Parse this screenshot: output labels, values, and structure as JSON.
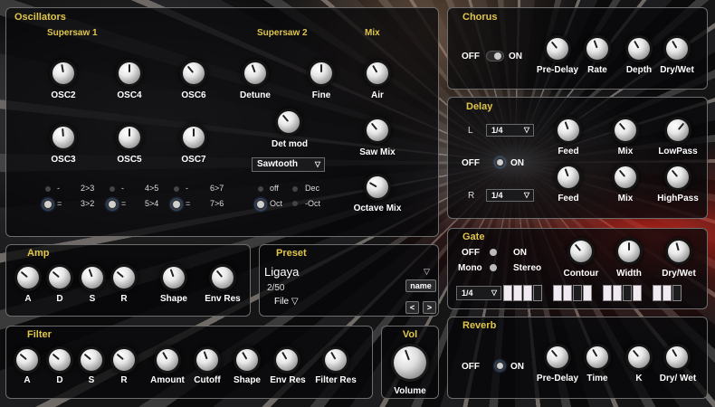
{
  "oscillators": {
    "title": "Oscillators",
    "supersaw1": "Supersaw 1",
    "supersaw2": "Supersaw 2",
    "mix": "Mix",
    "knobs": [
      "OSC2",
      "OSC4",
      "OSC6",
      "OSC3",
      "OSC5",
      "OSC7",
      "Detune",
      "Fine",
      "Air",
      "Det mod",
      "Saw Mix",
      "Octave Mix"
    ],
    "waveform": "Sawtooth",
    "dash": "-",
    "eq": "=",
    "pairs": [
      "2>3",
      "3>2",
      "4>5",
      "5>4",
      "6>7",
      "7>6"
    ],
    "mod_opts": [
      "off",
      "Dec",
      "Oct",
      "-Oct"
    ]
  },
  "chorus": {
    "title": "Chorus",
    "off": "OFF",
    "on": "ON",
    "knobs": [
      "Pre-Delay",
      "Rate",
      "Depth",
      "Dry/Wet"
    ]
  },
  "delay": {
    "title": "Delay",
    "l": "L",
    "r": "R",
    "l_value": "1/4",
    "r_value": "1/4",
    "off": "OFF",
    "on": "ON",
    "knobs": [
      "Feed",
      "Mix",
      "LowPass",
      "Feed",
      "Mix",
      "HighPass"
    ]
  },
  "gate": {
    "title": "Gate",
    "off": "OFF",
    "on": "ON",
    "mono": "Mono",
    "stereo": "Stereo",
    "rate": "1/4",
    "knobs": [
      "Contour",
      "Width",
      "Dry/Wet"
    ],
    "steps": [
      1,
      1,
      1,
      0,
      1,
      1,
      0,
      1,
      1,
      1,
      0,
      1,
      1,
      1,
      0
    ]
  },
  "amp": {
    "title": "Amp",
    "knobs": [
      "A",
      "D",
      "S",
      "R",
      "Shape",
      "Env Res"
    ]
  },
  "preset": {
    "title": "Preset",
    "name": "Ligaya",
    "count": "2/50",
    "file": "File",
    "name_btn": "name",
    "prev": "<",
    "next": ">"
  },
  "filter": {
    "title": "Filter",
    "knobs": [
      "A",
      "D",
      "S",
      "R",
      "Amount",
      "Cutoff",
      "Shape",
      "Env Res",
      "Filter Res"
    ]
  },
  "vol": {
    "title": "Vol",
    "label": "Volume"
  },
  "reverb": {
    "title": "Reverb",
    "off": "OFF",
    "on": "ON",
    "knobs": [
      "Pre-Delay",
      "Time",
      "K",
      "Dry/ Wet"
    ]
  },
  "icons": {
    "dropdown": "chevron-down-icon"
  },
  "colors": {
    "accent": "#e0c64a",
    "panel_border": "#6d6d6d"
  }
}
